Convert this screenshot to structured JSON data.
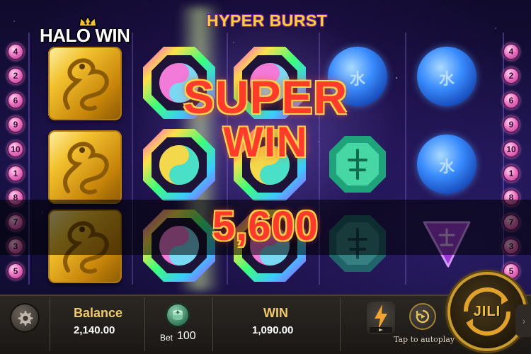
{
  "game": {
    "title": "HYPER BURST",
    "brand": "HALO WIN"
  },
  "paylines": {
    "left": [
      "4",
      "2",
      "6",
      "9",
      "10",
      "1",
      "8",
      "7",
      "3",
      "5"
    ],
    "right": [
      "4",
      "2",
      "6",
      "9",
      "10",
      "1",
      "8",
      "7",
      "3",
      "5"
    ]
  },
  "win": {
    "banner_line1": "SUPER",
    "banner_line2": "WIN",
    "amount": "5,600"
  },
  "reels": {
    "columns": [
      [
        "golden-dragon",
        "golden-dragon",
        "golden-dragon"
      ],
      [
        "yin-yang",
        "yin-yang",
        "yin-yang"
      ],
      [
        "yin-yang",
        "yin-yang",
        "yin-yang"
      ],
      [
        "blue-water-orb",
        "green-jade",
        "green-jade"
      ],
      [
        "blue-water-orb",
        "blue-water-orb",
        "purple-triangle"
      ]
    ],
    "orb_glyph": "水"
  },
  "bottom_bar": {
    "balance_label": "Balance",
    "balance_value": "2,140.00",
    "bet_label": "Bet",
    "bet_value": "100",
    "win_label": "WIN",
    "win_value": "1,090.00",
    "autoplay_label": "Tap to autoplay",
    "spin_label": "JILI",
    "edge_arrow": "›"
  },
  "colors": {
    "gold": "#f1c96a",
    "win_red": "#ff3a2c",
    "payline_pink": "#e86cbd",
    "orb_blue": "#3a8cff"
  }
}
